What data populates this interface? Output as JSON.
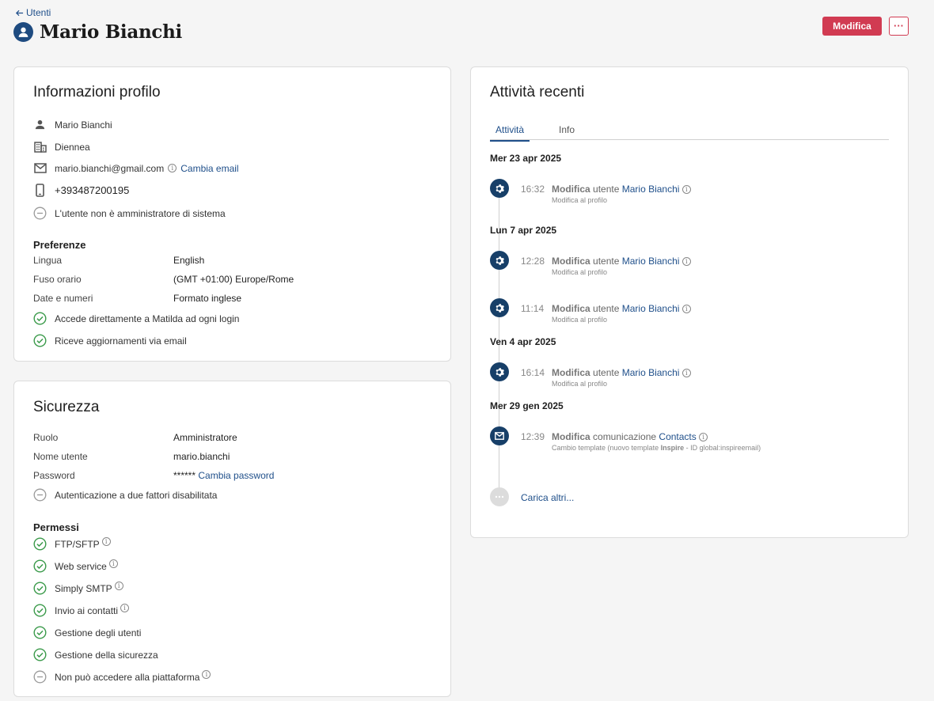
{
  "header": {
    "back_label": "Utenti",
    "title": "Mario Bianchi",
    "edit_label": "Modifica",
    "more_label": "···"
  },
  "profile": {
    "title": "Informazioni profilo",
    "name": "Mario Bianchi",
    "company": "Diennea",
    "email": "mario.bianchi@gmail.com",
    "change_email": "Cambia email",
    "phone": "+393487200195",
    "admin_status": "L'utente non è amministratore di sistema",
    "preferences_title": "Preferenze",
    "preferences": [
      {
        "label": "Lingua",
        "value": "English"
      },
      {
        "label": "Fuso orario",
        "value": "(GMT +01:00) Europe/Rome"
      },
      {
        "label": "Date e numeri",
        "value": "Formato inglese"
      }
    ],
    "flags": [
      "Accede direttamente a Matilda ad ogni login",
      "Riceve aggiornamenti via email"
    ]
  },
  "security": {
    "title": "Sicurezza",
    "fields": [
      {
        "label": "Ruolo",
        "value": "Amministratore"
      },
      {
        "label": "Nome utente",
        "value": "mario.bianchi"
      },
      {
        "label": "Password",
        "value": "******"
      }
    ],
    "change_password": "Cambia password",
    "two_factor": "Autenticazione a due fattori disabilitata",
    "permissions_title": "Permessi",
    "permissions": [
      {
        "label": "FTP/SFTP",
        "enabled": true,
        "info": true
      },
      {
        "label": "Web service",
        "enabled": true,
        "info": true
      },
      {
        "label": "Simply SMTP",
        "enabled": true,
        "info": true
      },
      {
        "label": "Invio ai contatti",
        "enabled": true,
        "info": true
      },
      {
        "label": "Gestione degli utenti",
        "enabled": true,
        "info": false
      },
      {
        "label": "Gestione della sicurezza",
        "enabled": true,
        "info": false
      },
      {
        "label": "Non può accedere alla piattaforma",
        "enabled": false,
        "info": true
      }
    ]
  },
  "activity": {
    "title": "Attività recenti",
    "tabs": [
      "Attività",
      "Info"
    ],
    "groups": [
      {
        "date": "Mer 23 apr 2025",
        "events": [
          {
            "time": "16:32",
            "action": "Modifica",
            "object": "utente",
            "target": "Mario Bianchi",
            "detail": "Modifica al profilo",
            "icon": "gear-icon"
          }
        ]
      },
      {
        "date": "Lun 7 apr 2025",
        "events": [
          {
            "time": "12:28",
            "action": "Modifica",
            "object": "utente",
            "target": "Mario Bianchi",
            "detail": "Modifica al profilo",
            "icon": "gear-icon"
          },
          {
            "time": "11:14",
            "action": "Modifica",
            "object": "utente",
            "target": "Mario Bianchi",
            "detail": "Modifica al profilo",
            "icon": "gear-icon"
          }
        ]
      },
      {
        "date": "Ven 4 apr 2025",
        "events": [
          {
            "time": "16:14",
            "action": "Modifica",
            "object": "utente",
            "target": "Mario Bianchi",
            "detail": "Modifica al profilo",
            "icon": "gear-icon"
          }
        ]
      },
      {
        "date": "Mer 29 gen 2025",
        "events": [
          {
            "time": "12:39",
            "action": "Modifica",
            "object": "comunicazione",
            "target": "Contacts",
            "detail_prefix": "Cambio template (nuovo template ",
            "detail_bold": "Inspire",
            "detail_suffix": " - ID global:inspireemail)",
            "icon": "mail-icon"
          }
        ]
      }
    ],
    "load_more": "Carica altri..."
  },
  "colors": {
    "accent": "#d13b52",
    "link": "#1f4f8a",
    "navy": "#173f68",
    "success": "#3a9a4a"
  }
}
